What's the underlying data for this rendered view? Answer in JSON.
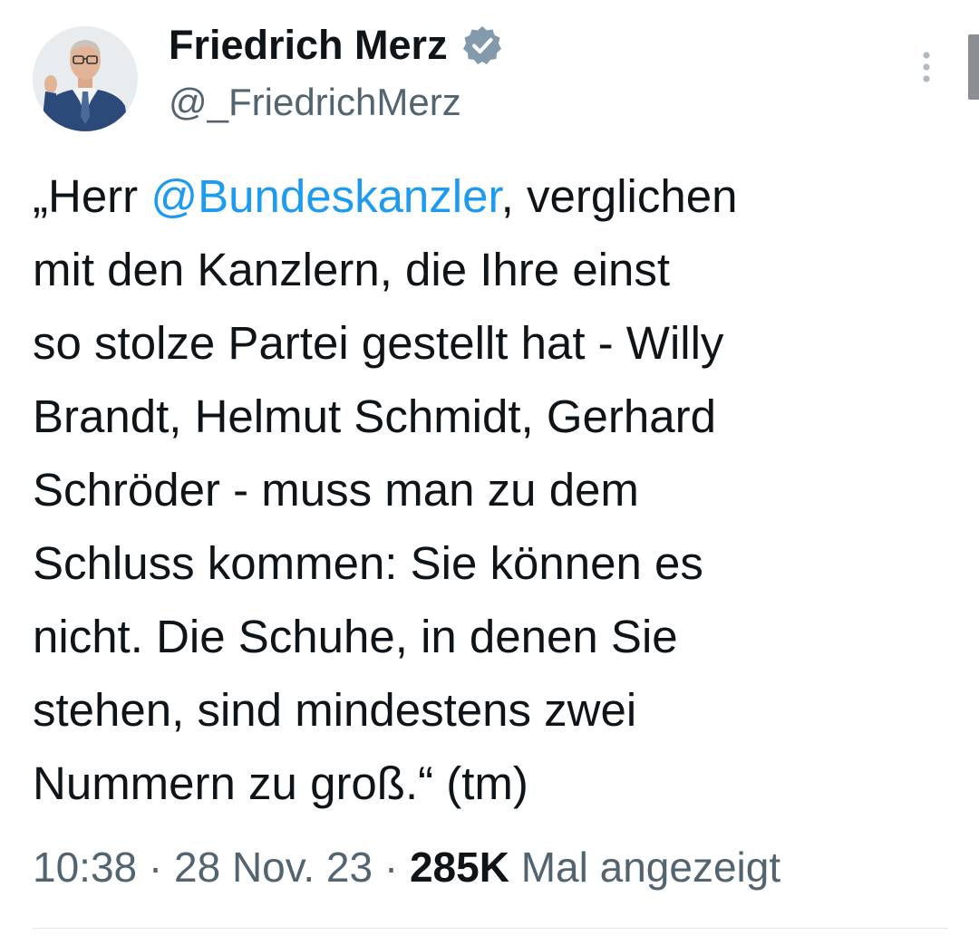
{
  "author": {
    "display_name": "Friedrich Merz",
    "handle": "@_FriedrichMerz",
    "verified_badge_color": "#829aab",
    "avatar_icon": "profile-photo"
  },
  "tweet": {
    "lines": [
      [
        "„Herr ",
        "@Bundeskanzler",
        ", verglichen"
      ],
      [
        "mit den Kanzlern, die Ihre einst"
      ],
      [
        "so stolze Partei gestellt hat - Willy"
      ],
      [
        "Brandt, Helmut Schmidt, Gerhard"
      ],
      [
        "Schröder - muss man zu dem"
      ],
      [
        "Schluss kommen: Sie können es"
      ],
      [
        "nicht. Die Schuhe, in denen Sie"
      ],
      [
        "stehen, sind mindestens zwei"
      ],
      [
        "Nummern zu groß.“ (tm)"
      ]
    ],
    "mention_color": "#1d9bf0"
  },
  "meta": {
    "time": "10:38",
    "separator": " · ",
    "date": "28 Nov. 23",
    "views_count": "285K",
    "views_label": " Mal angezeigt"
  },
  "icons": {
    "more": "more-vertical-icon",
    "verified": "verified-badge-icon"
  }
}
